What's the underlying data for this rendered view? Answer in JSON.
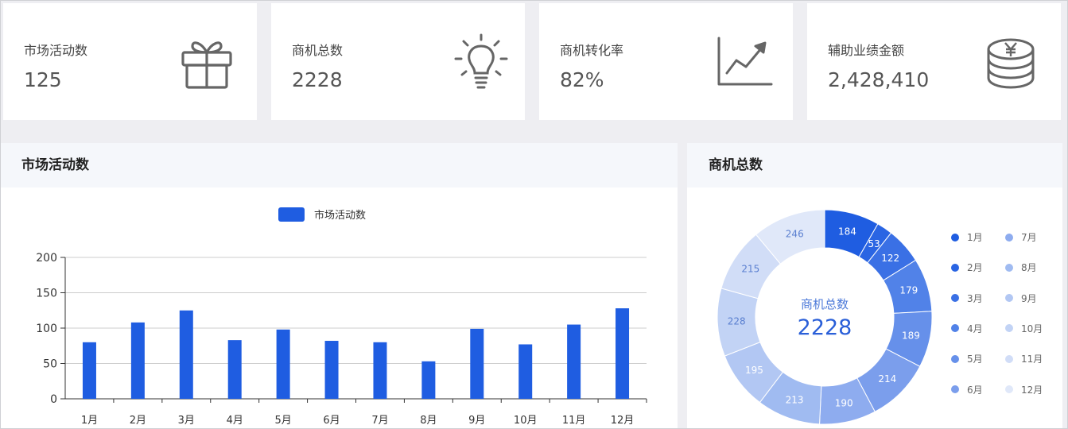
{
  "cards": [
    {
      "label": "市场活动数",
      "value": "125",
      "icon": "gift-icon"
    },
    {
      "label": "商机总数",
      "value": "2228",
      "icon": "lightbulb-icon"
    },
    {
      "label": "商机转化率",
      "value": "82%",
      "icon": "trend-chart-icon"
    },
    {
      "label": "辅助业绩金额",
      "value": "2,428,410",
      "icon": "coin-stack-icon"
    }
  ],
  "left_panel": {
    "title": "市场活动数"
  },
  "right_panel": {
    "title": "商机总数",
    "center_label": "商机总数",
    "center_value": "2228"
  },
  "colors": {
    "accent": "#1f5de1",
    "icon": "#666666"
  },
  "chart_data": [
    {
      "type": "bar",
      "title": "市场活动数",
      "categories": [
        "1月",
        "2月",
        "3月",
        "4月",
        "5月",
        "6月",
        "7月",
        "8月",
        "9月",
        "10月",
        "11月",
        "12月"
      ],
      "series": [
        {
          "name": "市场活动数",
          "values": [
            80,
            108,
            125,
            83,
            98,
            82,
            80,
            53,
            99,
            77,
            105,
            128
          ]
        }
      ],
      "ylim": [
        0,
        200
      ],
      "yticks": [
        0,
        50,
        100,
        150,
        200
      ],
      "legend": "top-center",
      "grid": true
    },
    {
      "type": "pie",
      "title": "商机总数",
      "categories": [
        "1月",
        "2月",
        "3月",
        "4月",
        "5月",
        "6月",
        "7月",
        "8月",
        "9月",
        "10月",
        "11月",
        "12月"
      ],
      "values": [
        184,
        53,
        122,
        179,
        189,
        214,
        190,
        213,
        195,
        228,
        215,
        246
      ],
      "colors": [
        "#1f5de1",
        "#2a65e3",
        "#3a70e5",
        "#5182e8",
        "#6690ea",
        "#7b9eec",
        "#8eacef",
        "#a0bbf1",
        "#b2c7f3",
        "#c2d3f5",
        "#d1ddf7",
        "#e0e8f9"
      ],
      "legend": "right"
    }
  ]
}
